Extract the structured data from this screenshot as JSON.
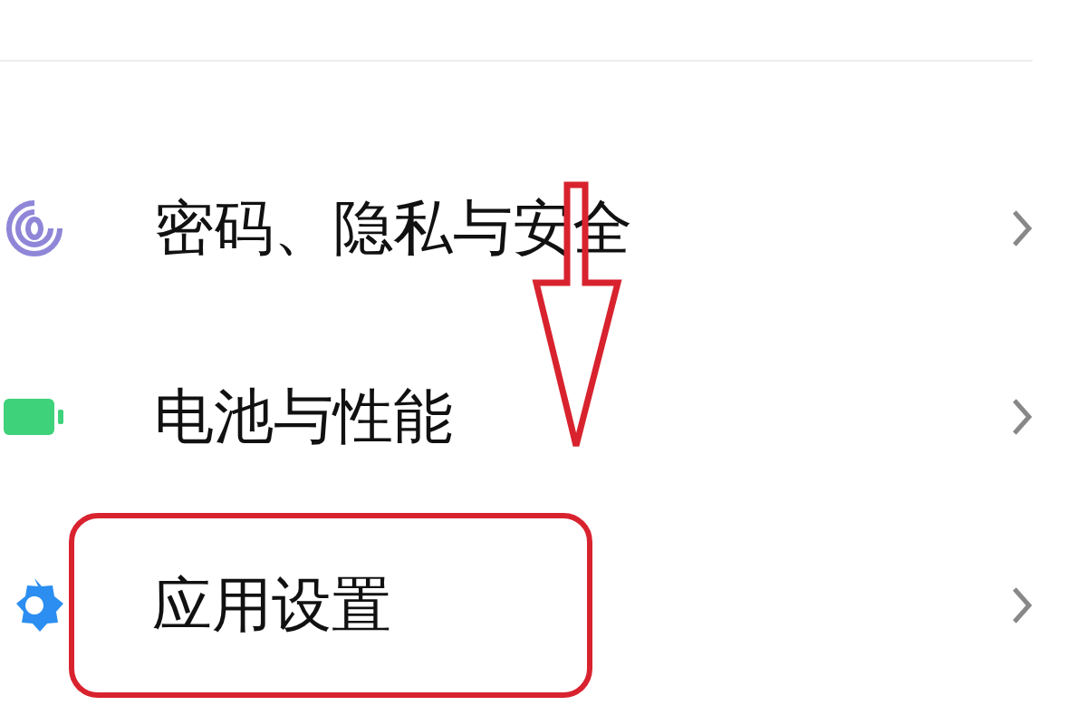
{
  "settings": [
    {
      "label": "密码、隐私与安全",
      "kind": "fingerprint",
      "highlighted": false
    },
    {
      "label": "电池与性能",
      "kind": "battery",
      "highlighted": false
    },
    {
      "label": "应用设置",
      "kind": "gear",
      "highlighted": true
    }
  ],
  "annotation_arrow": {
    "shown": true
  }
}
